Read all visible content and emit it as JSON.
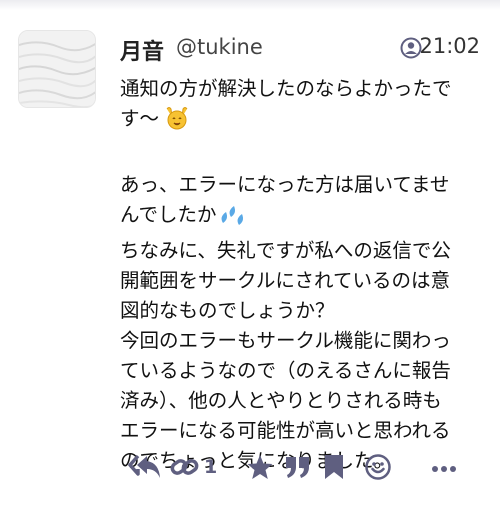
{
  "status": {
    "author_display_name": "月音",
    "author_handle": "@tukine",
    "time": "21:02",
    "visibility_icon": "followers-only-icon",
    "content": {
      "line1": "通知の方が解決したのならよかったで",
      "line2": "す〜",
      "line3": "あっ、エラーになった方は届いてませ",
      "line4": "んでしたか",
      "line5": "ちなみに、失礼ですが私への返信で公",
      "line6": "開範囲をサークルにされているのは意",
      "line7": "図的なものでしょうか？",
      "line8": "今回のエラーもサークル機能に関わっ",
      "line9": "ているようなので（のえるさんに報告",
      "line10": "済み）、他の人とやりとりされる時も",
      "line11": "エラーになる可能性が高いと思われる",
      "line12": "のでちょっと気になりました。"
    }
  },
  "actions": {
    "reply_count": "1",
    "icons": [
      "reply-all-icon",
      "link-icon",
      "star-icon",
      "quote-icon",
      "bookmark-icon",
      "emoji-react-icon",
      "more-icon"
    ]
  },
  "colors": {
    "icon": "#5f5f80",
    "text": "#111111"
  }
}
